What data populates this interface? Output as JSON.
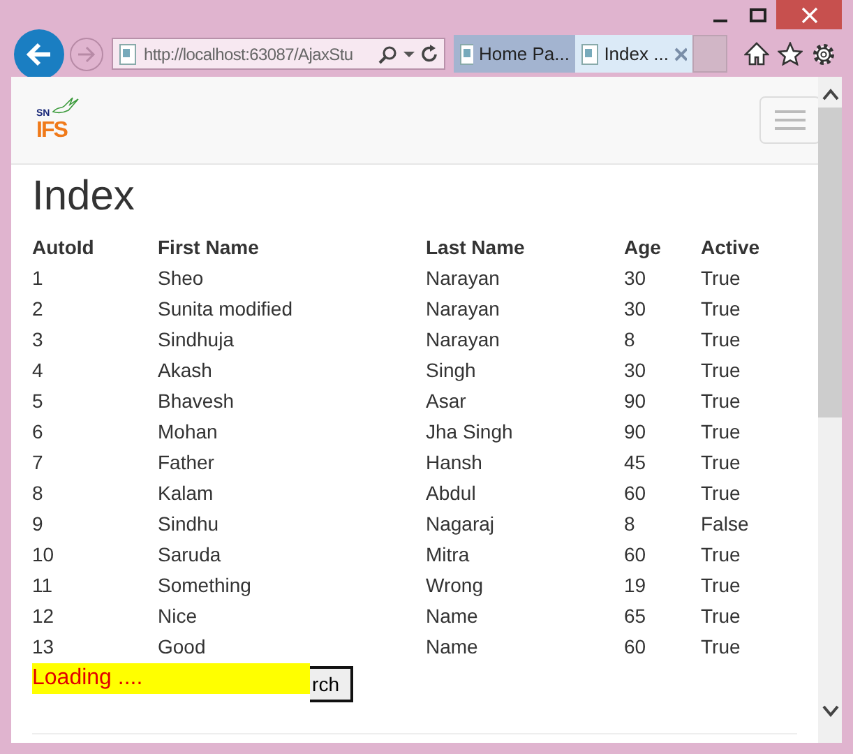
{
  "browser": {
    "address": "http://localhost:63087/AjaxStu",
    "tabs": [
      {
        "label": "Home Pa...",
        "selected": false
      },
      {
        "label": "Index ...",
        "selected": true
      }
    ]
  },
  "logo": {
    "small": "SN",
    "large": "IFS"
  },
  "title": "Index",
  "table": {
    "columns": [
      "AutoId",
      "First Name",
      "Last Name",
      "Age",
      "Active"
    ],
    "rows": [
      [
        "1",
        "Sheo",
        "Narayan",
        "30",
        "True"
      ],
      [
        "2",
        "Sunita modified",
        "Narayan",
        "30",
        "True"
      ],
      [
        "3",
        "Sindhuja",
        "Narayan",
        "8",
        "True"
      ],
      [
        "4",
        "Akash",
        "Singh",
        "30",
        "True"
      ],
      [
        "5",
        "Bhavesh",
        "Asar",
        "90",
        "True"
      ],
      [
        "6",
        "Mohan",
        "Jha Singh",
        "90",
        "True"
      ],
      [
        "7",
        "Father",
        "Hansh",
        "45",
        "True"
      ],
      [
        "8",
        "Kalam",
        "Abdul",
        "60",
        "True"
      ],
      [
        "9",
        "Sindhu",
        "Nagaraj",
        "8",
        "False"
      ],
      [
        "10",
        "Saruda",
        "Mitra",
        "60",
        "True"
      ],
      [
        "11",
        "Something",
        "Wrong",
        "19",
        "True"
      ],
      [
        "12",
        "Nice",
        "Name",
        "65",
        "True"
      ],
      [
        "13",
        "Good",
        "Name",
        "60",
        "True"
      ]
    ]
  },
  "search_button": "rch",
  "loading": "Loading ...."
}
